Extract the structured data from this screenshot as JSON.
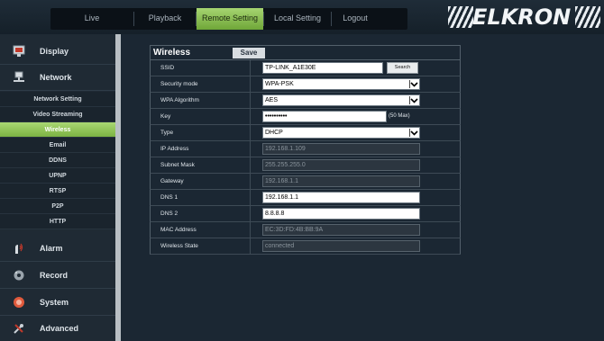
{
  "nav": {
    "tabs": [
      {
        "label": "Live"
      },
      {
        "label": "Playback"
      },
      {
        "label": "Remote Setting",
        "active": true
      },
      {
        "label": "Local Setting"
      },
      {
        "label": "Logout"
      }
    ]
  },
  "brand": {
    "logo_text": "ELKRON"
  },
  "sidebar": {
    "main": [
      {
        "label": "Display",
        "icon": "monitor-icon"
      },
      {
        "label": "Network",
        "icon": "network-icon"
      },
      {
        "label": "Alarm",
        "icon": "alarm-icon"
      },
      {
        "label": "Record",
        "icon": "record-icon"
      },
      {
        "label": "System",
        "icon": "system-icon"
      },
      {
        "label": "Advanced",
        "icon": "tools-icon"
      }
    ],
    "network_sub": [
      {
        "label": "Network Setting"
      },
      {
        "label": "Video Streaming"
      },
      {
        "label": "Wireless",
        "active": true
      },
      {
        "label": "Email"
      },
      {
        "label": "DDNS"
      },
      {
        "label": "UPNP"
      },
      {
        "label": "RTSP"
      },
      {
        "label": "P2P"
      },
      {
        "label": "HTTP"
      }
    ]
  },
  "panel": {
    "title": "Wireless",
    "save_label": "Save",
    "fields": {
      "ssid": {
        "label": "SSID",
        "value": "TP-LINK_A1E30E",
        "button": "Search"
      },
      "security_mode": {
        "label": "Security mode",
        "value": "WPA-PSK"
      },
      "wpa_algorithm": {
        "label": "WPA Algorithm",
        "value": "AES"
      },
      "key": {
        "label": "Key",
        "value": "••••••••••",
        "hint": "(50 Max)"
      },
      "type": {
        "label": "Type",
        "value": "DHCP"
      },
      "ip_address": {
        "label": "IP Address",
        "value": "192.168.1.109"
      },
      "subnet_mask": {
        "label": "Subnet Mask",
        "value": "255.255.255.0"
      },
      "gateway": {
        "label": "Gateway",
        "value": "192.168.1.1"
      },
      "dns1": {
        "label": "DNS 1",
        "value": "192.168.1.1"
      },
      "dns2": {
        "label": "DNS 2",
        "value": "8.8.8.8"
      },
      "mac_address": {
        "label": "MAC Address",
        "value": "EC:3D:FD:4B:BB:9A"
      },
      "wireless_state": {
        "label": "Wireless State",
        "value": "connected"
      }
    }
  },
  "colors": {
    "accent": "#8cc152",
    "background": "#1b2733",
    "sidebar": "#1f2a34"
  }
}
